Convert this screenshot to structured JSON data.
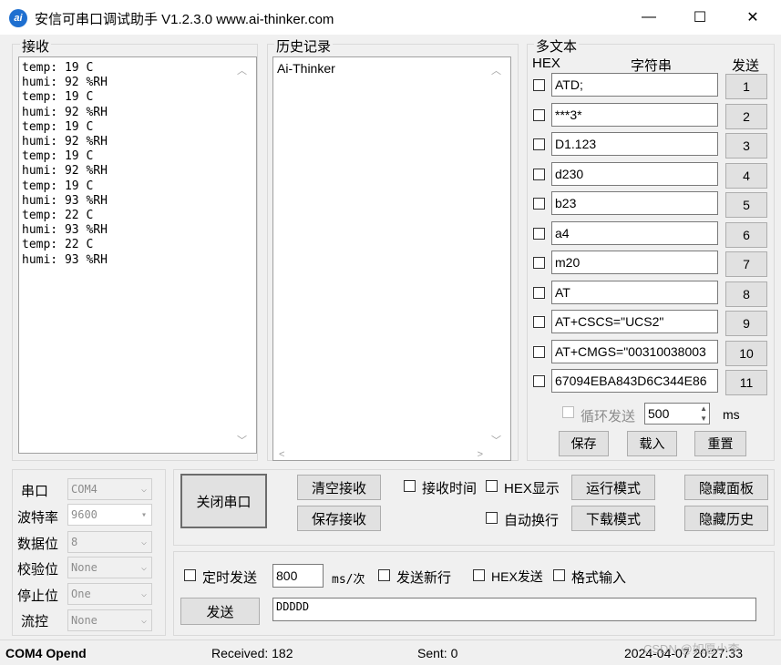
{
  "window": {
    "title": "安信可串口调试助手 V1.2.3.0    www.ai-thinker.com",
    "icon_text": "ai",
    "minimize": "—",
    "maximize": "☐",
    "close": "✕"
  },
  "receive": {
    "label": "接收",
    "lines": [
      "temp: 19 C",
      "humi: 92 %RH",
      "temp: 19 C",
      "humi: 92 %RH",
      "temp: 19 C",
      "humi: 92 %RH",
      "temp: 19 C",
      "humi: 92 %RH",
      "temp: 19 C",
      "humi: 93 %RH",
      "temp: 22 C",
      "humi: 93 %RH",
      "temp: 22 C",
      "humi: 93 %RH"
    ]
  },
  "history": {
    "label": "历史记录",
    "items": [
      "Ai-Thinker"
    ]
  },
  "multitext": {
    "label": "多文本",
    "col_hex": "HEX",
    "col_string": "字符串",
    "col_send": "发送",
    "rows": [
      {
        "text": "ATD;",
        "num": "1"
      },
      {
        "text": "***3*",
        "num": "2"
      },
      {
        "text": "D1.123",
        "num": "3"
      },
      {
        "text": "d230",
        "num": "4"
      },
      {
        "text": "b23",
        "num": "5"
      },
      {
        "text": "a4",
        "num": "6"
      },
      {
        "text": "m20",
        "num": "7"
      },
      {
        "text": "AT",
        "num": "8"
      },
      {
        "text": "AT+CSCS=\"UCS2\"",
        "num": "9"
      },
      {
        "text": "AT+CMGS=\"00310038003",
        "num": "10"
      },
      {
        "text": "67094EBA843D6C344E86",
        "num": "11"
      }
    ],
    "loop_send": "循环发送",
    "loop_ms": "500",
    "ms_unit": "ms",
    "save": "保存",
    "load": "载入",
    "reset": "重置"
  },
  "serial": {
    "port_label": "串口",
    "port_value": "COM4",
    "baud_label": "波特率",
    "baud_value": "9600",
    "databits_label": "数据位",
    "databits_value": "8",
    "parity_label": "校验位",
    "parity_value": "None",
    "stopbits_label": "停止位",
    "stopbits_value": "One",
    "flow_label": "流控",
    "flow_value": "None"
  },
  "controls": {
    "close_port": "关闭串口",
    "clear_recv": "清空接收",
    "save_recv": "保存接收",
    "recv_time": "接收时间",
    "hex_display": "HEX显示",
    "auto_wrap": "自动换行",
    "run_mode": "运行模式",
    "download_mode": "下载模式",
    "hide_panel": "隐藏面板",
    "hide_history": "隐藏历史"
  },
  "send": {
    "timed_send": "定时发送",
    "interval": "800",
    "interval_unit": "ms/次",
    "send_newline": "发送新行",
    "hex_send": "HEX发送",
    "format_input": "格式输入",
    "send_button": "发送",
    "send_text": "DDDDD"
  },
  "status": {
    "port": "COM4 Opend",
    "received": "Received: 182",
    "sent": "Sent: 0",
    "datetime": "2024-04-07 20:27:33",
    "watermark": "CSDN @如愿小李"
  }
}
